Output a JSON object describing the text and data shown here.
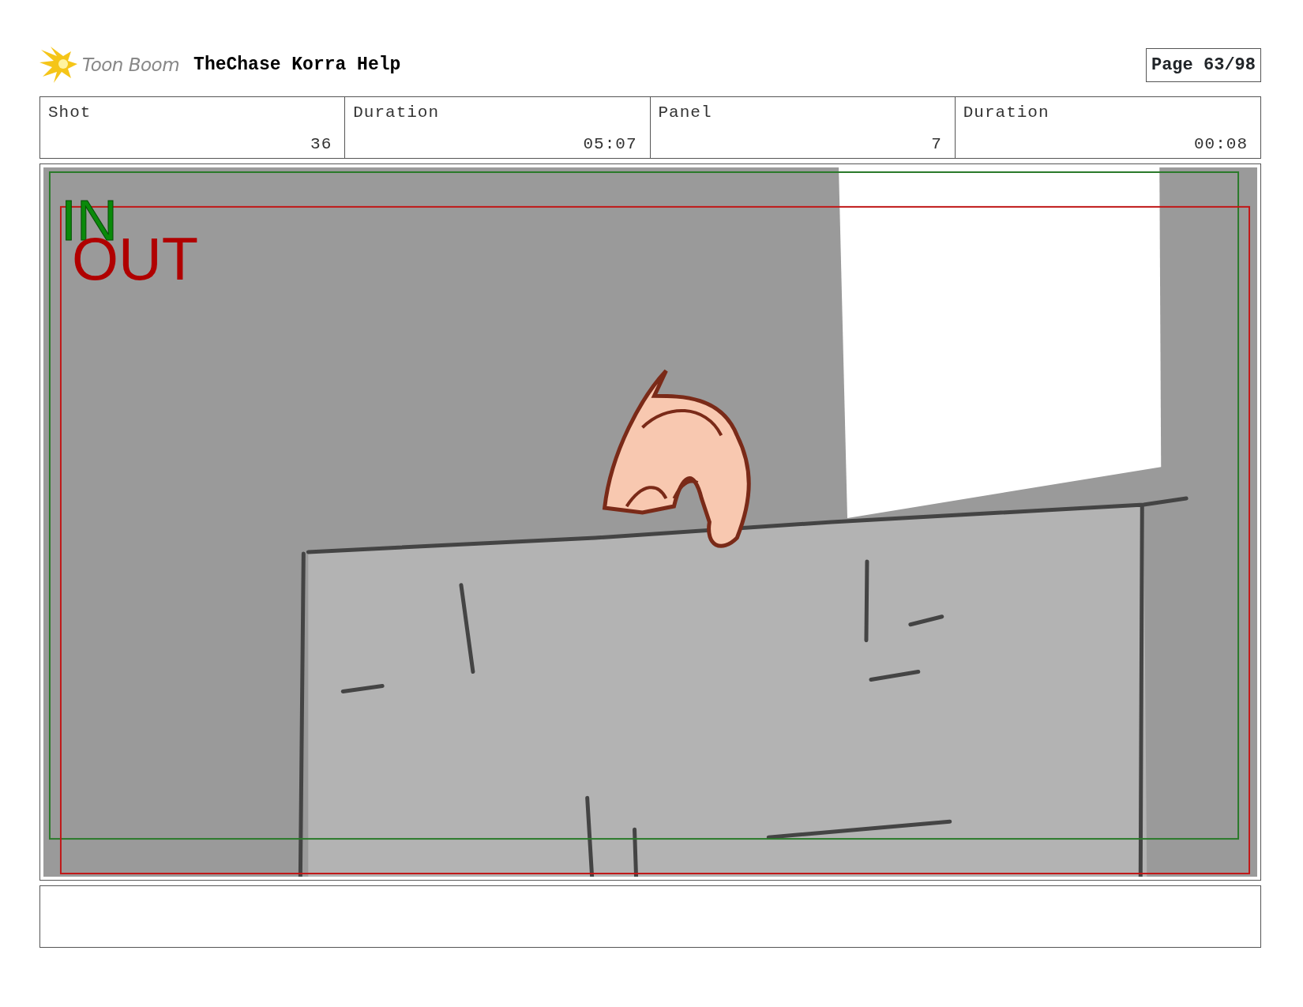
{
  "header": {
    "logo_text": "Toon Boom",
    "title": "TheChase Korra Help",
    "page": "Page 63/98"
  },
  "fields": [
    {
      "label": "Shot",
      "value": "36"
    },
    {
      "label": "Duration",
      "value": "05:07"
    },
    {
      "label": "Panel",
      "value": "7"
    },
    {
      "label": "Duration",
      "value": "00:08"
    }
  ],
  "panel": {
    "in_label": "IN",
    "out_label": "OUT"
  }
}
